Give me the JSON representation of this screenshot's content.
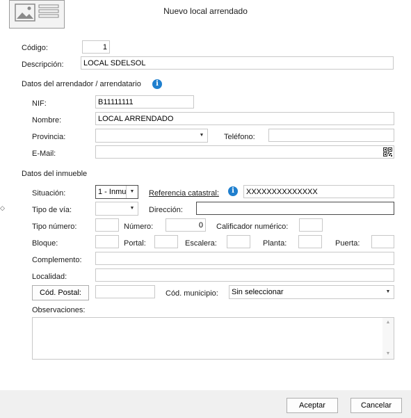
{
  "window": {
    "title": "Nuevo local arrendado"
  },
  "form": {
    "codigo": {
      "label": "Código:",
      "value": "1"
    },
    "descripcion": {
      "label": "Descripción:",
      "value": "LOCAL SDELSOL"
    }
  },
  "arrendador": {
    "section_title": "Datos del arrendador / arrendatario",
    "nif": {
      "label": "NIF:",
      "value": "B11111111"
    },
    "nombre": {
      "label": "Nombre:",
      "value": "LOCAL ARRENDADO"
    },
    "provincia": {
      "label": "Provincia:",
      "value": ""
    },
    "telefono": {
      "label": "Teléfono:",
      "value": ""
    },
    "email": {
      "label": "E-Mail:",
      "value": ""
    }
  },
  "inmueble": {
    "section_title": "Datos del inmueble",
    "situacion": {
      "label": "Situación:",
      "value": "1 - Inmu"
    },
    "referencia_catastral": {
      "label": "Referencia catastral:",
      "value": "XXXXXXXXXXXXXX"
    },
    "tipo_via": {
      "label": "Tipo de vía:",
      "value": ""
    },
    "direccion": {
      "label": "Dirección:",
      "value": ""
    },
    "tipo_numero": {
      "label": "Tipo número:",
      "value": ""
    },
    "numero": {
      "label": "Número:",
      "value": "0"
    },
    "calificador": {
      "label": "Calificador numérico:",
      "value": ""
    },
    "bloque": {
      "label": "Bloque:",
      "value": ""
    },
    "portal": {
      "label": "Portal:",
      "value": ""
    },
    "escalera": {
      "label": "Escalera:",
      "value": ""
    },
    "planta": {
      "label": "Planta:",
      "value": ""
    },
    "puerta": {
      "label": "Puerta:",
      "value": ""
    },
    "complemento": {
      "label": "Complemento:",
      "value": ""
    },
    "localidad": {
      "label": "Localidad:",
      "value": ""
    },
    "cod_postal": {
      "label": "Cód. Postal:",
      "value": ""
    },
    "cod_municipio": {
      "label": "Cód. municipio:",
      "value": "Sin seleccionar"
    },
    "observaciones": {
      "label": "Observaciones:",
      "value": ""
    }
  },
  "buttons": {
    "accept": "Aceptar",
    "cancel": "Cancelar"
  },
  "colors": {
    "info_icon": "#1f7fce",
    "footer_bg": "#f0f0f0"
  }
}
